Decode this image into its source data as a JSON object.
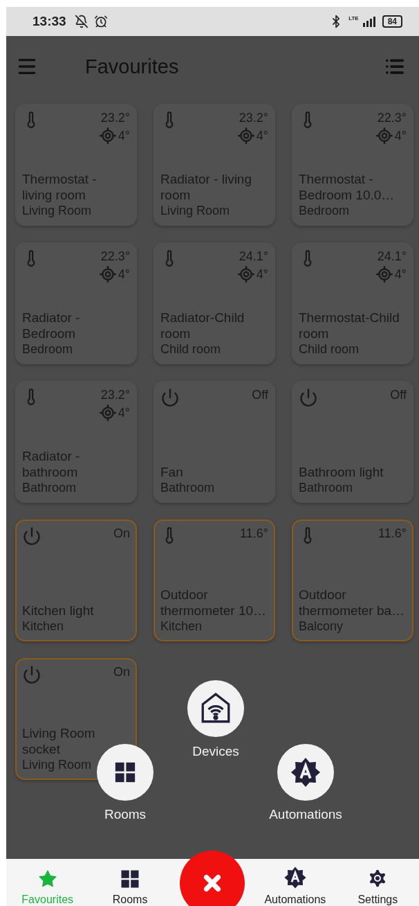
{
  "status_bar": {
    "time": "13:33",
    "network": "LTE",
    "battery": "84"
  },
  "header": {
    "title": "Favourites"
  },
  "devices": [
    {
      "kind": "thermostat",
      "name": "Thermostat - living room",
      "room": "Living Room",
      "temperature": "23.2°",
      "target": "4°",
      "active": false
    },
    {
      "kind": "thermostat",
      "name": "Radiator - living room",
      "room": "Living Room",
      "temperature": "23.2°",
      "target": "4°",
      "active": false
    },
    {
      "kind": "thermostat",
      "name": "Thermostat - Bedroom 10.0…",
      "room": "Bedroom",
      "temperature": "22.3°",
      "target": "4°",
      "active": false
    },
    {
      "kind": "thermostat",
      "name": "Radiator - Bedroom",
      "room": "Bedroom",
      "temperature": "22.3°",
      "target": "4°",
      "active": false
    },
    {
      "kind": "thermostat",
      "name": "Radiator-Child room",
      "room": "Child room",
      "temperature": "24.1°",
      "target": "4°",
      "active": false
    },
    {
      "kind": "thermostat",
      "name": "Thermostat-Child room",
      "room": "Child room",
      "temperature": "24.1°",
      "target": "4°",
      "active": false
    },
    {
      "kind": "thermostat",
      "name": "Radiator - bathroom",
      "room": "Bathroom",
      "temperature": "23.2°",
      "target": "4°",
      "active": false
    },
    {
      "kind": "switch",
      "name": "Fan",
      "room": "Bathroom",
      "state": "Off",
      "active": false
    },
    {
      "kind": "switch",
      "name": "Bathroom light",
      "room": "Bathroom",
      "state": "Off",
      "active": false
    },
    {
      "kind": "switch",
      "name": "Kitchen light",
      "room": "Kitchen",
      "state": "On",
      "active": true
    },
    {
      "kind": "sensor",
      "name": "Outdoor thermometer 10…",
      "room": "Kitchen",
      "temperature": "11.6°",
      "active": true
    },
    {
      "kind": "sensor",
      "name": "Outdoor thermometer ba…",
      "room": "Balcony",
      "temperature": "11.6°",
      "active": true
    },
    {
      "kind": "switch",
      "name": "Living Room socket",
      "room": "Living Room",
      "state": "On",
      "active": true
    }
  ],
  "quick_menu": [
    {
      "kind": "devices",
      "label": "Devices"
    },
    {
      "kind": "rooms",
      "label": "Rooms"
    },
    {
      "kind": "automations",
      "label": "Automations"
    }
  ],
  "nav": [
    {
      "kind": "favourites",
      "label": "Favourites",
      "selected": true
    },
    {
      "kind": "rooms",
      "label": "Rooms",
      "selected": false
    },
    {
      "kind": "close"
    },
    {
      "kind": "automations",
      "label": "Automations",
      "selected": false
    },
    {
      "kind": "settings",
      "label": "Settings",
      "selected": false
    }
  ]
}
